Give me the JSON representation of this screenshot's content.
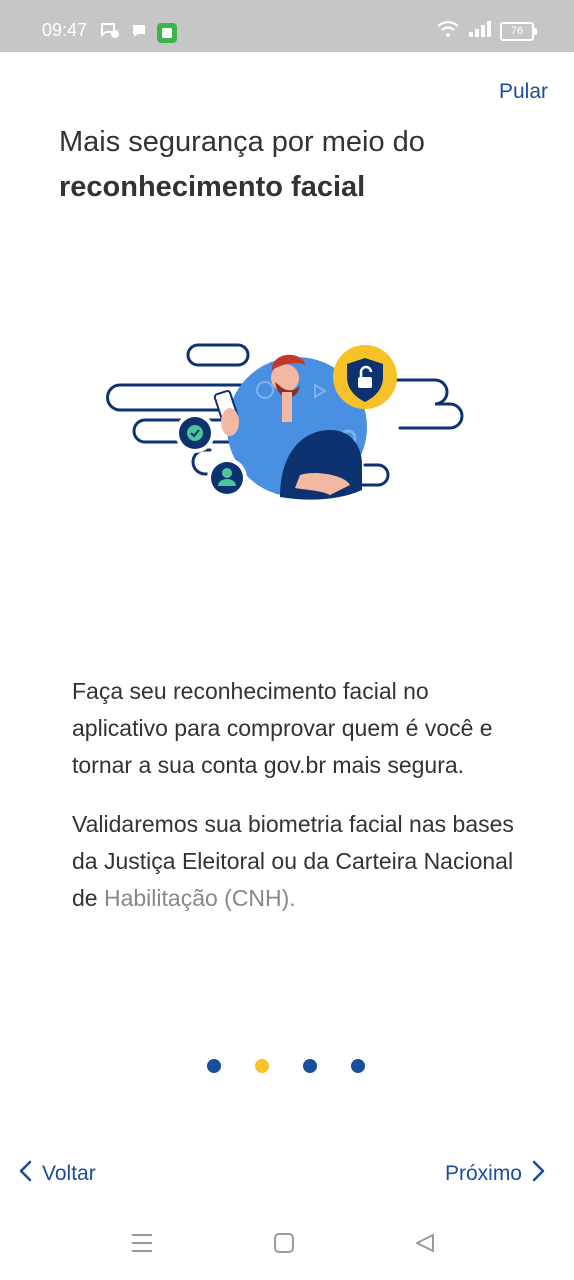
{
  "status_bar": {
    "time": "09:47",
    "battery": "76"
  },
  "header": {
    "skip_label": "Pular"
  },
  "title": {
    "line1": "Mais segurança por meio do",
    "line2": "reconhecimento facial"
  },
  "body": {
    "paragraph1": "Faça seu reconhecimento facial no aplicativo para comprovar quem é você e tornar a sua conta gov.br mais segura.",
    "paragraph2_main": "Validaremos sua biometria facial nas bases da Justiça Eleitoral ou da Carteira Nacional de",
    "paragraph2_faded": "Habilitação (CNH)."
  },
  "pagination": {
    "total": 4,
    "active_index": 1
  },
  "navigation": {
    "back_label": "Voltar",
    "next_label": "Próximo"
  },
  "colors": {
    "primary": "#1a4e9c",
    "accent": "#f6c227",
    "illustration_blue": "#4a90e2",
    "navy": "#0c326f"
  },
  "icons": [
    "wifi-icon",
    "signal-icon",
    "battery-icon",
    "chevron-left-icon",
    "chevron-right-icon",
    "menu-icon",
    "home-icon",
    "back-icon",
    "shield-lock-icon",
    "check-icon",
    "user-icon"
  ]
}
